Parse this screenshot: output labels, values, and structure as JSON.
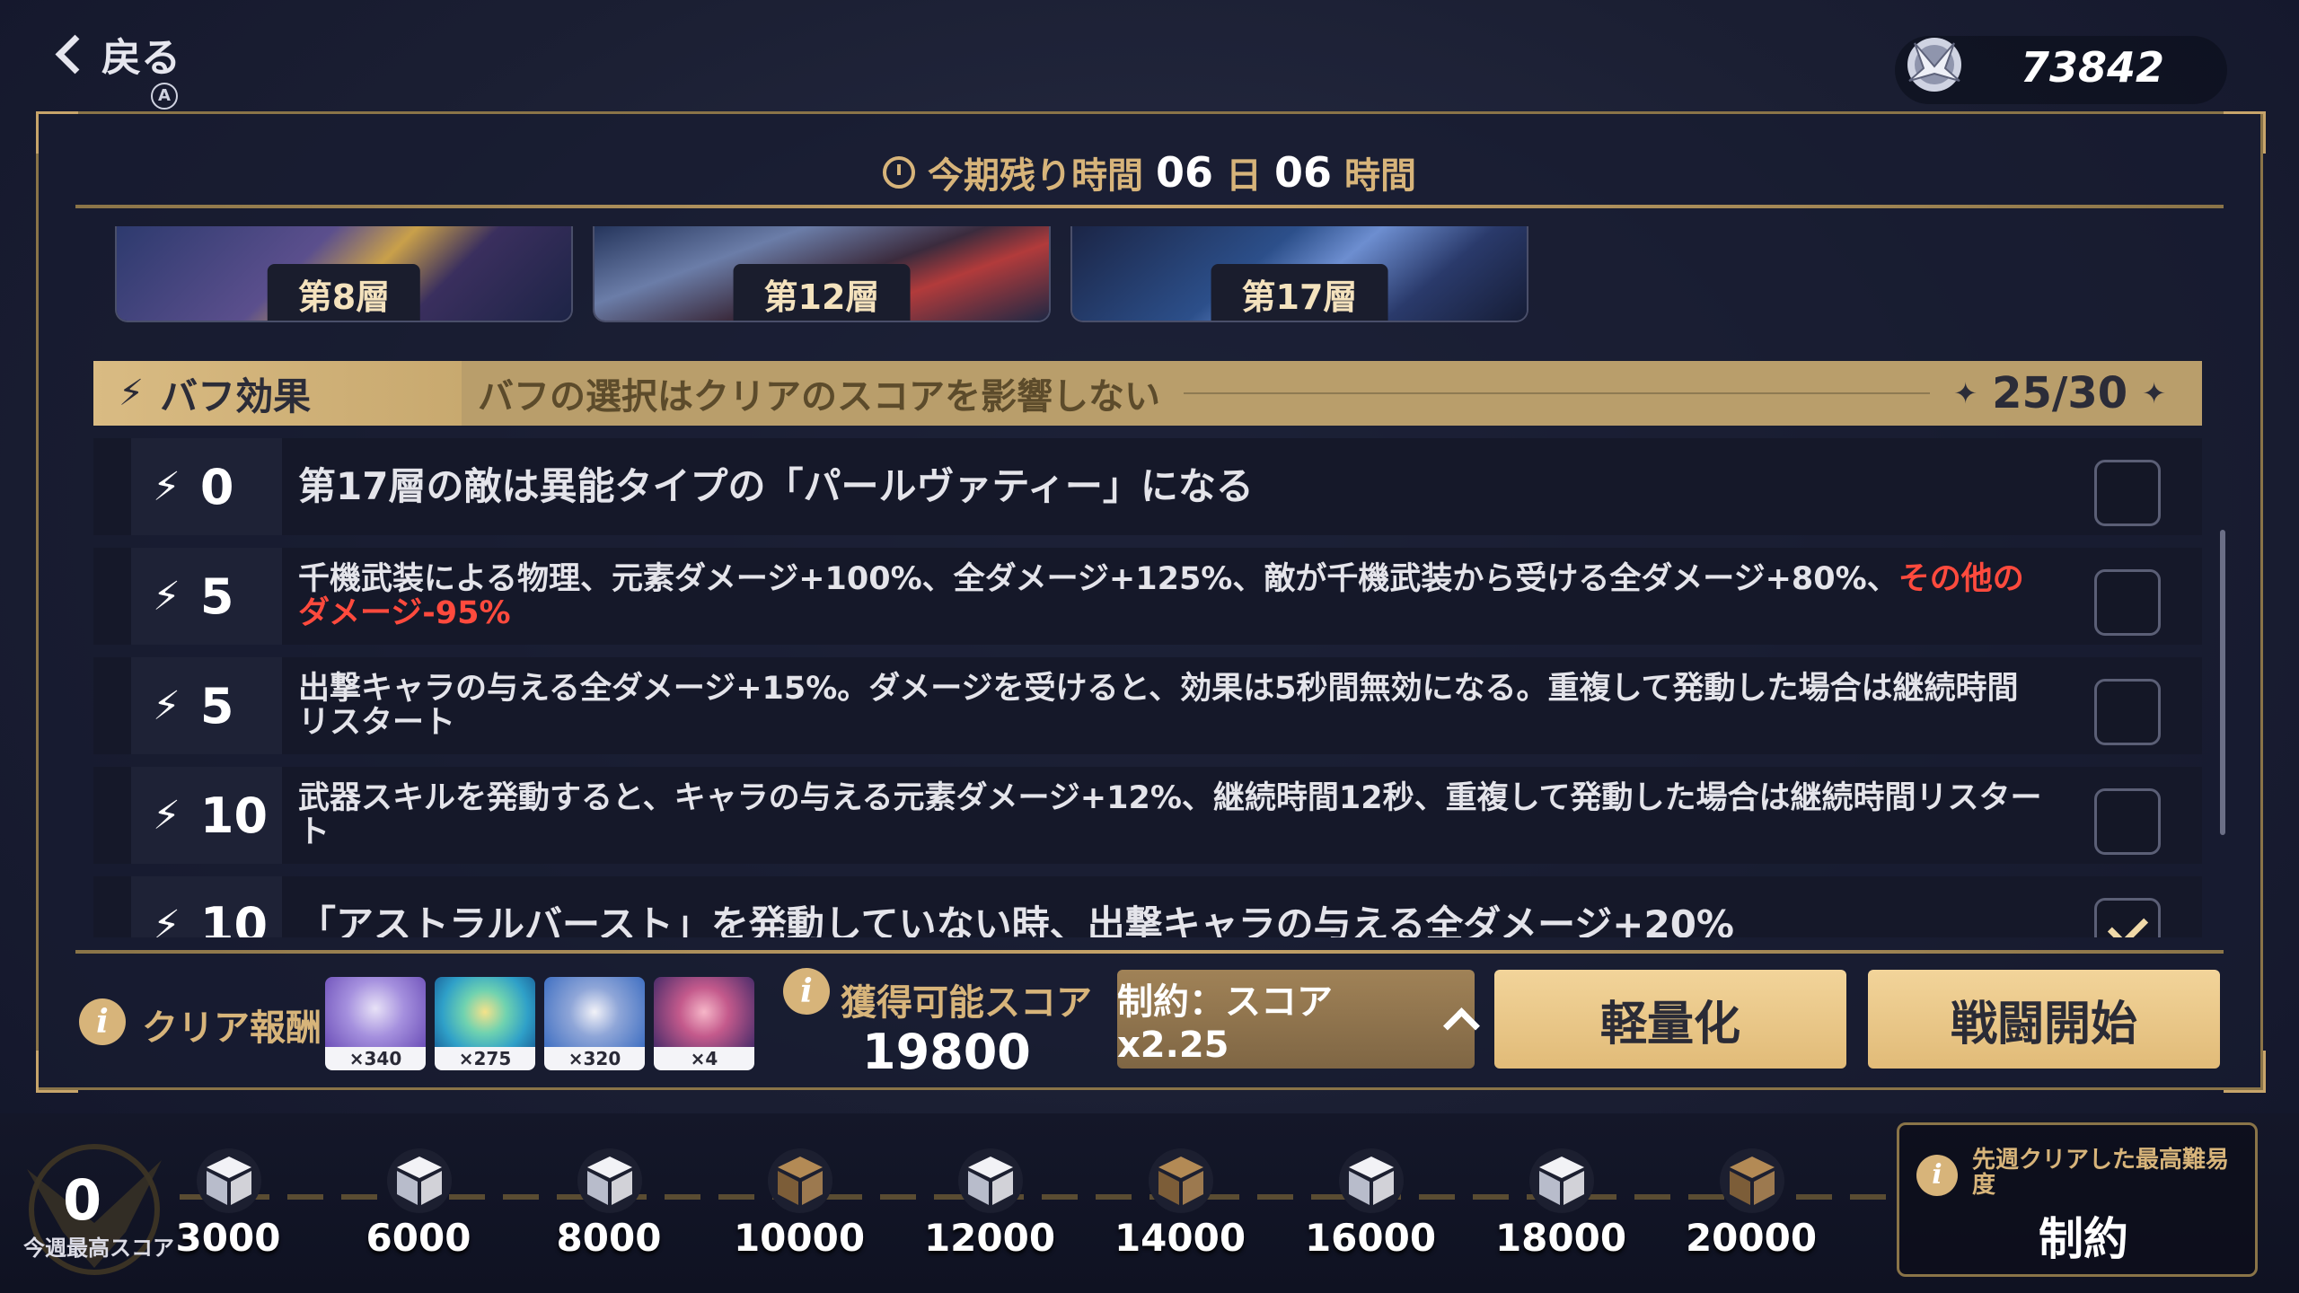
{
  "header": {
    "back_label": "戻る",
    "back_hint": "A",
    "currency_icon": "emblem-icon",
    "currency_value": "73842"
  },
  "timer": {
    "label_pre": "今期残り時間",
    "days": "06",
    "days_unit": "日",
    "hours": "06",
    "hours_unit": "時間"
  },
  "floors": [
    {
      "label": "第8層"
    },
    {
      "label": "第12層"
    },
    {
      "label": "第17層"
    }
  ],
  "buff_header": {
    "title": "バフ効果",
    "description": "バフの選択はクリアのスコアを影響しない",
    "count": "25/30"
  },
  "buffs": [
    {
      "cost": "0",
      "text": "第17層の敵は異能タイプの「パールヴァティー」になる",
      "red": "",
      "checked": false
    },
    {
      "cost": "5",
      "text": "千機武装による物理、元素ダメージ+100%、全ダメージ+125%、敵が千機武装から受ける全ダメージ+80%、",
      "red": "その他のダメージ-95%",
      "checked": false
    },
    {
      "cost": "5",
      "text": "出撃キャラの与える全ダメージ+15%。ダメージを受けると、効果は5秒間無効になる。重複して発動した場合は継続時間リスタート",
      "red": "",
      "checked": false
    },
    {
      "cost": "10",
      "text": "武器スキルを発動すると、キャラの与える元素ダメージ+12%、継続時間12秒、重複して発動した場合は継続時間リスタート",
      "red": "",
      "checked": false
    },
    {
      "cost": "10",
      "text": "「アストラルバースト」を発動していない時、出撃キャラの与える全ダメージ+20%",
      "red": "",
      "checked": true
    }
  ],
  "rewards": {
    "label": "クリア報酬",
    "items": [
      {
        "icon": "medal-icon",
        "qty": "×340",
        "color": "#8a6fd0"
      },
      {
        "icon": "chip-icon",
        "qty": "×275",
        "color": "#39b0c9"
      },
      {
        "icon": "helmet-icon",
        "qty": "×320",
        "color": "#4f8fd8"
      },
      {
        "icon": "flower-icon",
        "qty": "×4",
        "color": "#6a3d8f"
      }
    ]
  },
  "score": {
    "label": "獲得可能スコア",
    "value": "19800"
  },
  "actions": {
    "constraint": "制約：スコアx2.25",
    "lighten": "軽量化",
    "start": "戦闘開始"
  },
  "weekly": {
    "score": "0",
    "label": "今週最高スコア"
  },
  "milestones": [
    {
      "value": "3000",
      "achieved": false
    },
    {
      "value": "6000",
      "achieved": false
    },
    {
      "value": "8000",
      "achieved": false
    },
    {
      "value": "10000",
      "achieved": true
    },
    {
      "value": "12000",
      "achieved": false
    },
    {
      "value": "14000",
      "achieved": true
    },
    {
      "value": "16000",
      "achieved": false
    },
    {
      "value": "18000",
      "achieved": false
    },
    {
      "value": "20000",
      "achieved": true
    }
  ],
  "prev_week": {
    "label": "先週クリアした最高難易度",
    "value": "制約"
  },
  "colors": {
    "gold": "#d7b47a",
    "accent_red": "#ff4a3d",
    "button_gold": "#e8c78a"
  }
}
